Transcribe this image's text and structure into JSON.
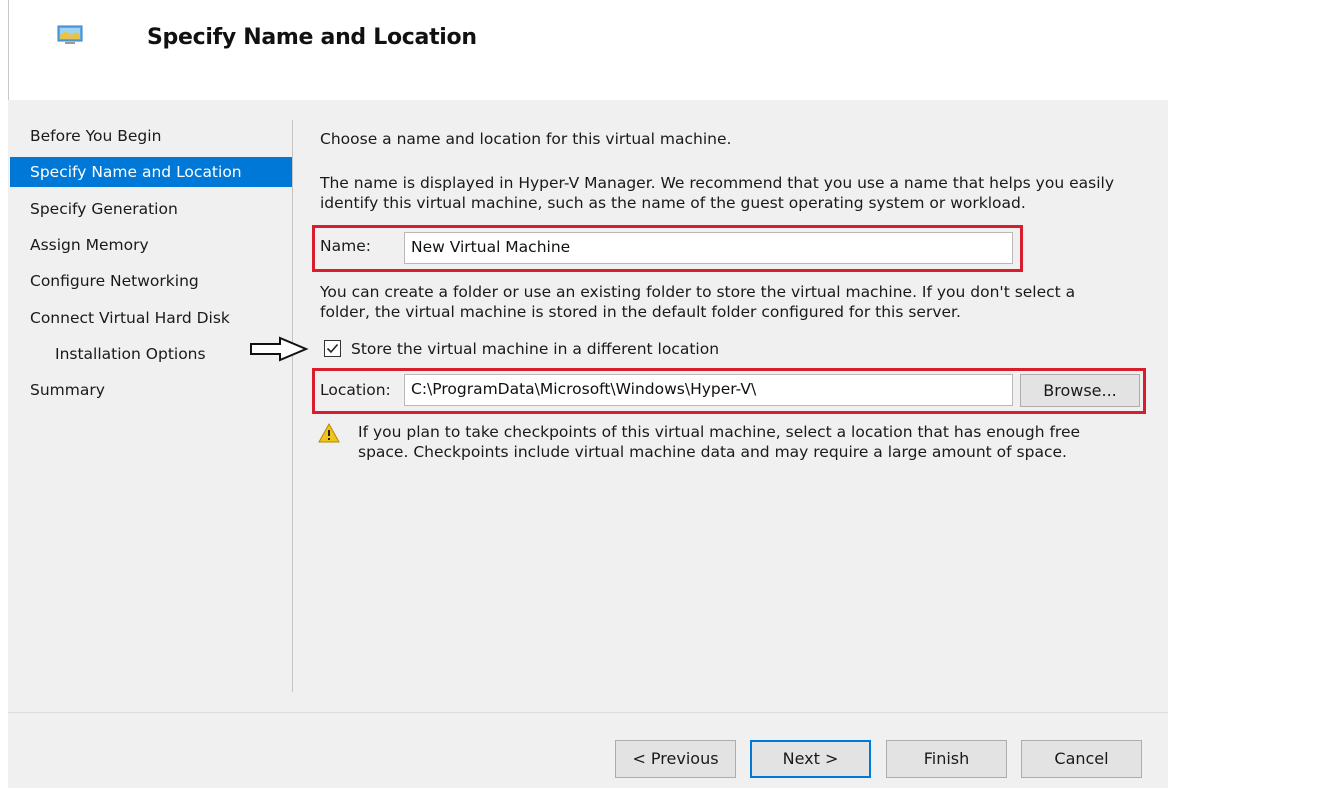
{
  "header": {
    "title": "Specify Name and Location",
    "icon": "virtual-machine-icon"
  },
  "nav": {
    "items": [
      {
        "label": "Before You Begin",
        "selected": false,
        "indent": false
      },
      {
        "label": "Specify Name and Location",
        "selected": true,
        "indent": false
      },
      {
        "label": "Specify Generation",
        "selected": false,
        "indent": false
      },
      {
        "label": "Assign Memory",
        "selected": false,
        "indent": false
      },
      {
        "label": "Configure Networking",
        "selected": false,
        "indent": false
      },
      {
        "label": "Connect Virtual Hard Disk",
        "selected": false,
        "indent": false
      },
      {
        "label": "Installation Options",
        "selected": false,
        "indent": true
      },
      {
        "label": "Summary",
        "selected": false,
        "indent": false
      }
    ]
  },
  "main": {
    "intro": "Choose a name and location for this virtual machine.",
    "description_line1": "The name is displayed in Hyper-V Manager. We recommend that you use a name that helps you easily",
    "description_line2": "identify this virtual machine, such as the name of the guest operating system or workload.",
    "name_label": "Name:",
    "name_value": "New Virtual Machine",
    "folder_line1": "You can create a folder or use an existing folder to store the virtual machine. If you don't select a",
    "folder_line2": "folder, the virtual machine is stored in the default folder configured for this server.",
    "store_checkbox_label": "Store the virtual machine in a different location",
    "store_checkbox_checked": true,
    "location_label": "Location:",
    "location_value": "C:\\ProgramData\\Microsoft\\Windows\\Hyper-V\\",
    "browse_label": "Browse...",
    "warning_line1": "If you plan to take checkpoints of this virtual machine, select a location that has enough free",
    "warning_line2": "space. Checkpoints include virtual machine data and may require a large amount of space.",
    "warning_icon": "warning-icon"
  },
  "footer": {
    "previous_label": "< Previous",
    "next_label": "Next >",
    "finish_label": "Finish",
    "cancel_label": "Cancel"
  },
  "colors": {
    "accent": "#0078d7",
    "highlight_box": "#d81e2c",
    "panel_bg": "#f0f0f0"
  }
}
